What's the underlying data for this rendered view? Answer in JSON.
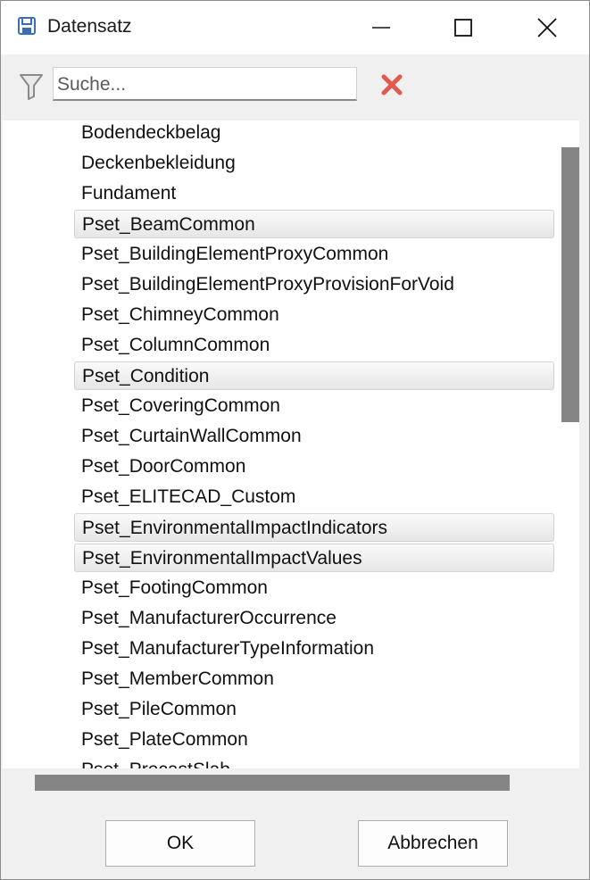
{
  "window": {
    "title": "Datensatz",
    "icon": "save-icon",
    "controls": [
      "minimize-icon",
      "maximize-icon",
      "close-icon"
    ]
  },
  "filter": {
    "icon": "filter-icon",
    "placeholder": "Suche...",
    "value": "",
    "clear_icon": "clear-x-icon",
    "clear_color": "#e05a4e"
  },
  "list": {
    "items": [
      {
        "label": "Bodendeckbelag",
        "selected": false
      },
      {
        "label": "Deckenbekleidung",
        "selected": false
      },
      {
        "label": "Fundament",
        "selected": false
      },
      {
        "label": "Pset_BeamCommon",
        "selected": true
      },
      {
        "label": "Pset_BuildingElementProxyCommon",
        "selected": false
      },
      {
        "label": "Pset_BuildingElementProxyProvisionForVoid",
        "selected": false
      },
      {
        "label": "Pset_ChimneyCommon",
        "selected": false
      },
      {
        "label": "Pset_ColumnCommon",
        "selected": false
      },
      {
        "label": "Pset_Condition",
        "selected": true
      },
      {
        "label": "Pset_CoveringCommon",
        "selected": false
      },
      {
        "label": "Pset_CurtainWallCommon",
        "selected": false
      },
      {
        "label": "Pset_DoorCommon",
        "selected": false
      },
      {
        "label": "Pset_ELITECAD_Custom",
        "selected": false
      },
      {
        "label": "Pset_EnvironmentalImpactIndicators",
        "selected": true
      },
      {
        "label": "Pset_EnvironmentalImpactValues",
        "selected": true
      },
      {
        "label": "Pset_FootingCommon",
        "selected": false
      },
      {
        "label": "Pset_ManufacturerOccurrence",
        "selected": false
      },
      {
        "label": "Pset_ManufacturerTypeInformation",
        "selected": false
      },
      {
        "label": "Pset_MemberCommon",
        "selected": false
      },
      {
        "label": "Pset_PileCommon",
        "selected": false
      },
      {
        "label": "Pset_PlateCommon",
        "selected": false
      },
      {
        "label": "Pset_PrecastSlab",
        "selected": false
      }
    ]
  },
  "buttons": {
    "ok": "OK",
    "cancel": "Abbrechen"
  }
}
